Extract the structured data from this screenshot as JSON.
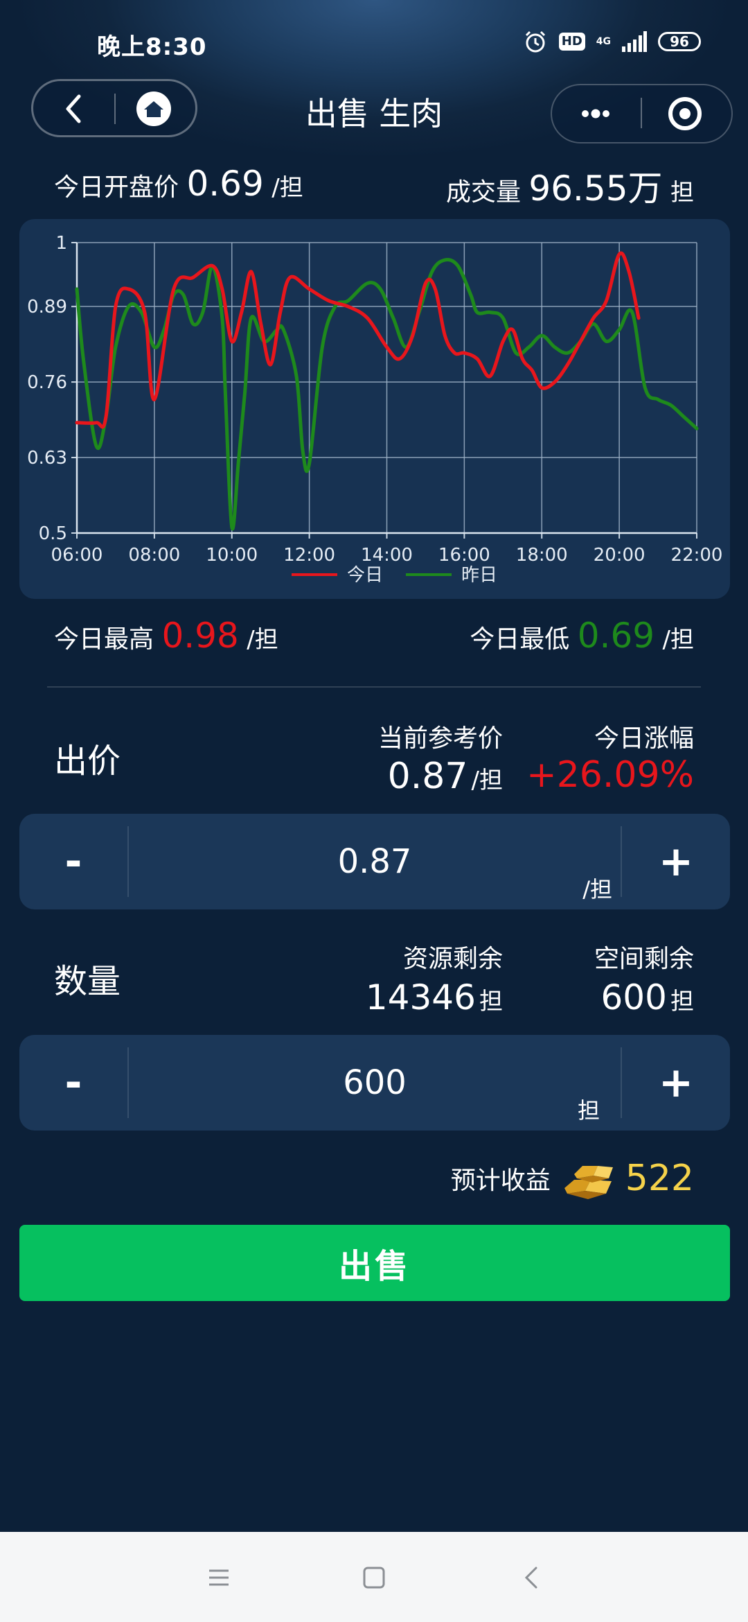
{
  "status_bar": {
    "time": "晚上8:30",
    "hd": "HD",
    "network": "4G",
    "battery": "96"
  },
  "nav": {
    "title": "出售 生肉"
  },
  "header": {
    "open_label": "今日开盘价",
    "open_value": "0.69",
    "open_unit": "/担",
    "volume_label": "成交量",
    "volume_value": "96.55万",
    "volume_unit": "担"
  },
  "chart_data": {
    "type": "line",
    "x_ticks": [
      "06:00",
      "08:00",
      "10:00",
      "12:00",
      "14:00",
      "16:00",
      "18:00",
      "20:00",
      "22:00"
    ],
    "y_ticks": [
      "1",
      "0.89",
      "0.76",
      "0.63",
      "0.5"
    ],
    "ylim": [
      0.5,
      1.0
    ],
    "xlim": [
      "06:00",
      "22:00"
    ],
    "grid": true,
    "legend_position": "bottom",
    "series": [
      {
        "name": "今日",
        "color": "#e8161c",
        "x": [
          "06:00",
          "06:30",
          "06:45",
          "07:00",
          "07:20",
          "07:45",
          "08:00",
          "08:30",
          "09:00",
          "09:30",
          "09:45",
          "10:00",
          "10:15",
          "10:30",
          "10:45",
          "11:00",
          "11:15",
          "11:30",
          "12:00",
          "12:30",
          "13:00",
          "13:30",
          "14:00",
          "14:20",
          "14:40",
          "15:00",
          "15:15",
          "15:30",
          "15:45",
          "16:00",
          "16:20",
          "16:40",
          "17:00",
          "17:15",
          "17:30",
          "17:45",
          "18:00",
          "18:20",
          "18:40",
          "19:00",
          "19:20",
          "19:40",
          "20:00",
          "20:15",
          "20:30"
        ],
        "y": [
          0.69,
          0.69,
          0.7,
          0.89,
          0.92,
          0.88,
          0.73,
          0.92,
          0.94,
          0.96,
          0.92,
          0.83,
          0.88,
          0.95,
          0.86,
          0.79,
          0.88,
          0.94,
          0.92,
          0.9,
          0.89,
          0.87,
          0.82,
          0.8,
          0.84,
          0.93,
          0.92,
          0.84,
          0.81,
          0.81,
          0.8,
          0.77,
          0.83,
          0.85,
          0.8,
          0.78,
          0.75,
          0.76,
          0.79,
          0.83,
          0.87,
          0.9,
          0.98,
          0.95,
          0.87
        ]
      },
      {
        "name": "昨日",
        "color": "#1e8a1c",
        "x": [
          "06:00",
          "06:10",
          "06:30",
          "06:45",
          "07:00",
          "07:20",
          "07:40",
          "08:00",
          "08:15",
          "08:30",
          "08:45",
          "09:00",
          "09:15",
          "09:30",
          "09:45",
          "09:50",
          "10:00",
          "10:10",
          "10:20",
          "10:30",
          "10:50",
          "11:10",
          "11:20",
          "11:40",
          "11:50",
          "12:00",
          "12:20",
          "12:40",
          "13:00",
          "13:30",
          "13:50",
          "14:10",
          "14:30",
          "14:50",
          "15:10",
          "15:30",
          "15:50",
          "16:10",
          "16:20",
          "16:40",
          "17:00",
          "17:20",
          "17:40",
          "18:00",
          "18:20",
          "18:40",
          "19:00",
          "19:20",
          "19:40",
          "20:00",
          "20:20",
          "20:40",
          "21:00",
          "21:20",
          "21:40",
          "22:00"
        ],
        "y": [
          0.92,
          0.8,
          0.65,
          0.7,
          0.82,
          0.89,
          0.88,
          0.82,
          0.85,
          0.91,
          0.91,
          0.86,
          0.88,
          0.96,
          0.87,
          0.74,
          0.51,
          0.62,
          0.74,
          0.87,
          0.83,
          0.85,
          0.85,
          0.77,
          0.64,
          0.62,
          0.82,
          0.89,
          0.9,
          0.93,
          0.92,
          0.87,
          0.82,
          0.88,
          0.95,
          0.97,
          0.96,
          0.91,
          0.88,
          0.88,
          0.87,
          0.81,
          0.82,
          0.84,
          0.82,
          0.81,
          0.83,
          0.86,
          0.83,
          0.85,
          0.88,
          0.75,
          0.73,
          0.72,
          0.7,
          0.68
        ]
      }
    ]
  },
  "extremes": {
    "high_label": "今日最高",
    "high_value": "0.98",
    "high_unit": "/担",
    "low_label": "今日最低",
    "low_value": "0.69",
    "low_unit": "/担"
  },
  "price_section": {
    "label": "出价",
    "ref_label": "当前参考价",
    "ref_value": "0.87",
    "ref_unit": "/担",
    "change_label": "今日涨幅",
    "change_value": "+26.09%",
    "minus": "-",
    "plus": "+",
    "input_value": "0.87",
    "input_unit": "/担"
  },
  "qty_section": {
    "label": "数量",
    "resource_label": "资源剩余",
    "resource_value": "14346",
    "resource_unit": "担",
    "space_label": "空间剩余",
    "space_value": "600",
    "space_unit": "担",
    "minus": "-",
    "plus": "+",
    "input_value": "600",
    "input_unit": "担"
  },
  "income": {
    "label": "预计收益",
    "value": "522",
    "color": "#f5d24a"
  },
  "sell_button": {
    "label": "出售"
  },
  "system_nav": {
    "icons": [
      "menu-icon",
      "home-square-icon",
      "back-icon"
    ]
  }
}
